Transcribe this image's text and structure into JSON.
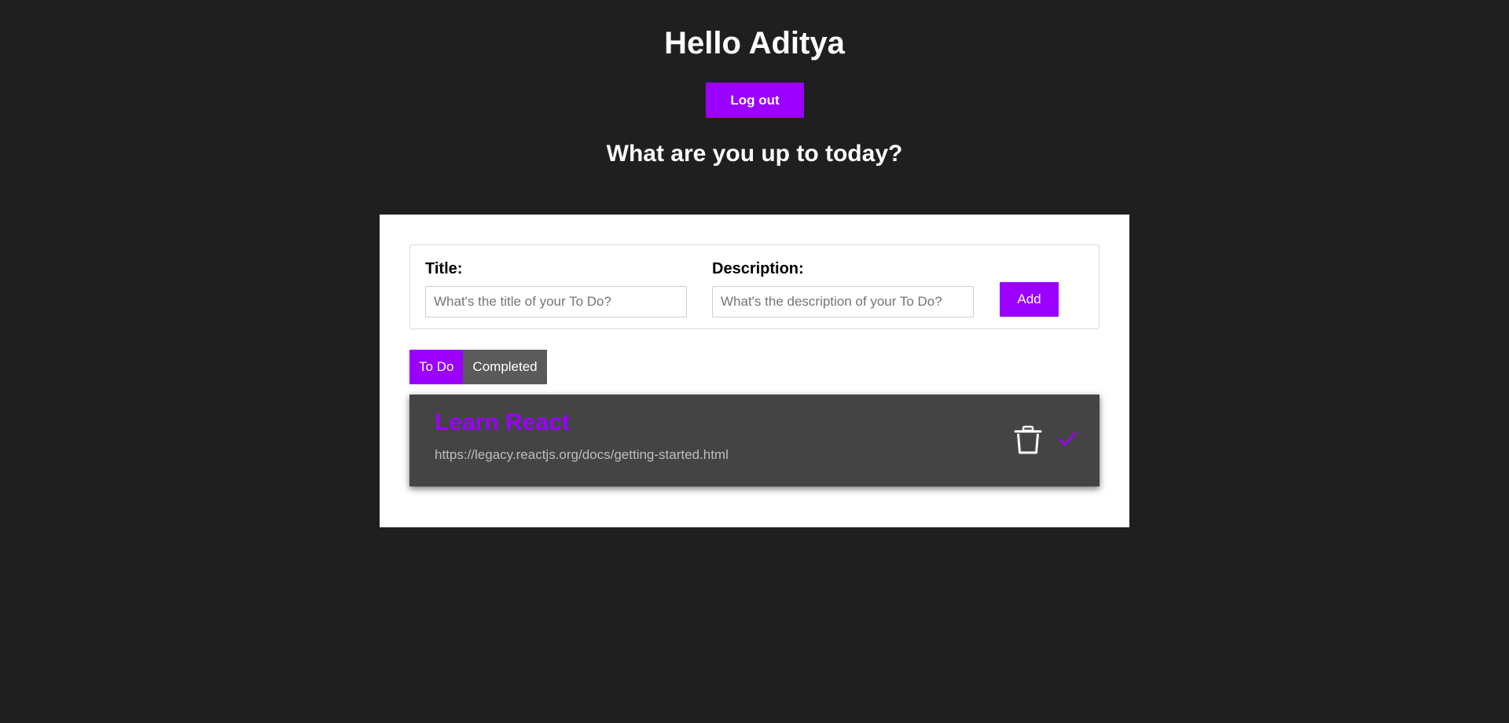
{
  "header": {
    "greeting": "Hello Aditya",
    "logout_label": "Log out",
    "subheading": "What are you up to today?"
  },
  "form": {
    "title_label": "Title:",
    "title_placeholder": "What's the title of your To Do?",
    "title_value": "",
    "description_label": "Description:",
    "description_placeholder": "What's the description of your To Do?",
    "description_value": "",
    "add_label": "Add"
  },
  "tabs": [
    {
      "label": "To Do",
      "active": true
    },
    {
      "label": "Completed",
      "active": false
    }
  ],
  "todos": [
    {
      "title": "Learn React",
      "description": "https://legacy.reactjs.org/docs/getting-started.html",
      "delete_icon": "trash-icon",
      "complete_icon": "check-icon"
    }
  ],
  "colors": {
    "accent": "#9b00ff",
    "background": "#1f1f1f",
    "card": "#ffffff",
    "todo_bg": "#444444",
    "tab_inactive": "#5a5a5a"
  }
}
